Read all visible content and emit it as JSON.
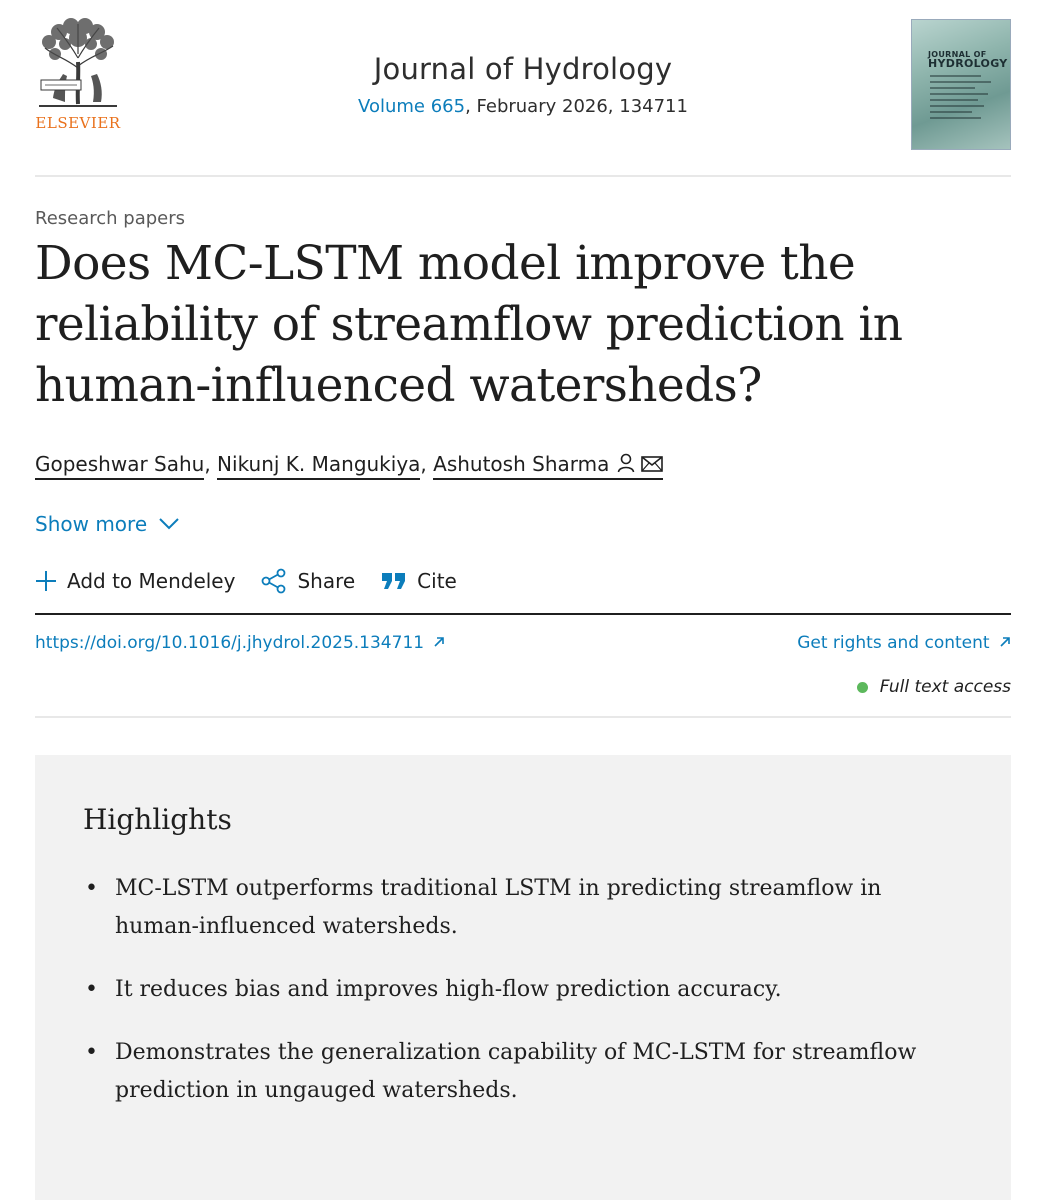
{
  "header": {
    "publisher": "ELSEVIER",
    "journal_title": "Journal of Hydrology",
    "volume_link": "Volume 665",
    "issue_meta": ", February 2026, 134711",
    "cover_title_line1": "JOURNAL OF",
    "cover_title_line2": "HYDROLOGY"
  },
  "article": {
    "type": "Research papers",
    "title": "Does MC-LSTM model improve the reliability of streamflow prediction in human-influenced watersheds?",
    "authors": [
      "Gopeshwar Sahu",
      "Nikunj K. Mangukiya",
      "Ashutosh Sharma"
    ],
    "author_separator": ", ",
    "show_more": "Show more"
  },
  "actions": {
    "add_to_mendeley": "Add to Mendeley",
    "share": "Share",
    "cite": "Cite"
  },
  "links": {
    "doi": "https://doi.org/10.1016/j.jhydrol.2025.134711",
    "rights": "Get rights and content",
    "access": "Full text access"
  },
  "highlights": {
    "title": "Highlights",
    "bullet": "•",
    "items": [
      "MC-LSTM outperforms traditional LSTM in predicting streamflow in human-influenced watersheds.",
      "It reduces bias and improves high-flow prediction accuracy.",
      "Demonstrates the generalization capability of MC-LSTM for streamflow prediction in ungauged watersheds."
    ]
  },
  "colors": {
    "link": "#0c7dbb",
    "publisher_orange": "#e9711c",
    "access_green": "#5cb85c",
    "highlight_bg": "#f2f2f2"
  },
  "icons": {
    "logo": "elsevier-tree-logo",
    "author_person": "person-icon",
    "author_email": "envelope-icon",
    "show_more": "chevron-down-icon",
    "mendeley": "plus-icon",
    "share": "share-icon",
    "cite": "quote-icon",
    "external": "external-arrow-icon"
  }
}
